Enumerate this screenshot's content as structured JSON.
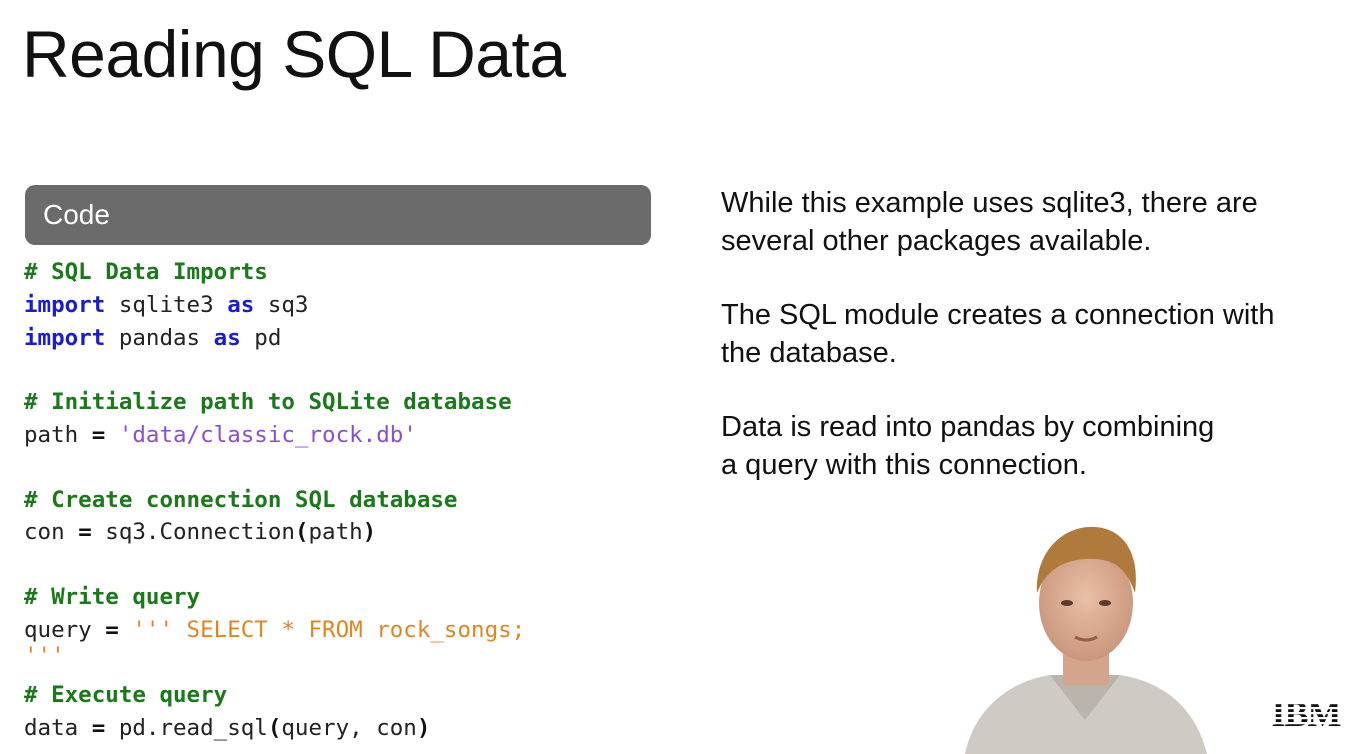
{
  "slide": {
    "title": "Reading SQL Data",
    "code_header": "Code"
  },
  "code": {
    "l1": "# SQL Data Imports",
    "l2_kw": "import",
    "l2_mod": " sqlite3 ",
    "l2_as": "as",
    "l2_alias": " sq3",
    "l3_kw": "import",
    "l3_mod": " pandas ",
    "l3_as": "as",
    "l3_alias": " pd",
    "l4": "# Initialize path to SQLite database",
    "l5_var": "path ",
    "l5_eq": "=",
    "l5_str": " 'data/classic_rock.db'",
    "l6": "# Create connection SQL database",
    "l7_var": "con ",
    "l7_eq": "=",
    "l7_call": " sq3.Connection",
    "l7_lp": "(",
    "l7_arg": "path",
    "l7_rp": ")",
    "l8": "# Write query",
    "l9_var": "query ",
    "l9_eq": "=",
    "l9_str": " ''' SELECT * FROM rock_songs;",
    "l10_str": "'''",
    "l11": "# Execute query",
    "l12_var": "data ",
    "l12_eq": "=",
    "l12_call": " pd.read_sql",
    "l12_lp": "(",
    "l12_arg": "query, con",
    "l12_rp": ")"
  },
  "notes": {
    "n1_a": "While this example uses sqlite3, there are",
    "n1_b": "several other packages available.",
    "n2_a": "The SQL module creates a connection with",
    "n2_b": "the database.",
    "n3_a": "Data is read into pandas by combining",
    "n3_b": "a query with this connection."
  },
  "brand": {
    "logo": "IBM"
  },
  "colors": {
    "comment": "#1a7a1a",
    "keyword": "#1b1bd0",
    "string_path": "#8a4fcf",
    "string_query": "#e0851f",
    "header_bg": "#6b6b6b"
  }
}
